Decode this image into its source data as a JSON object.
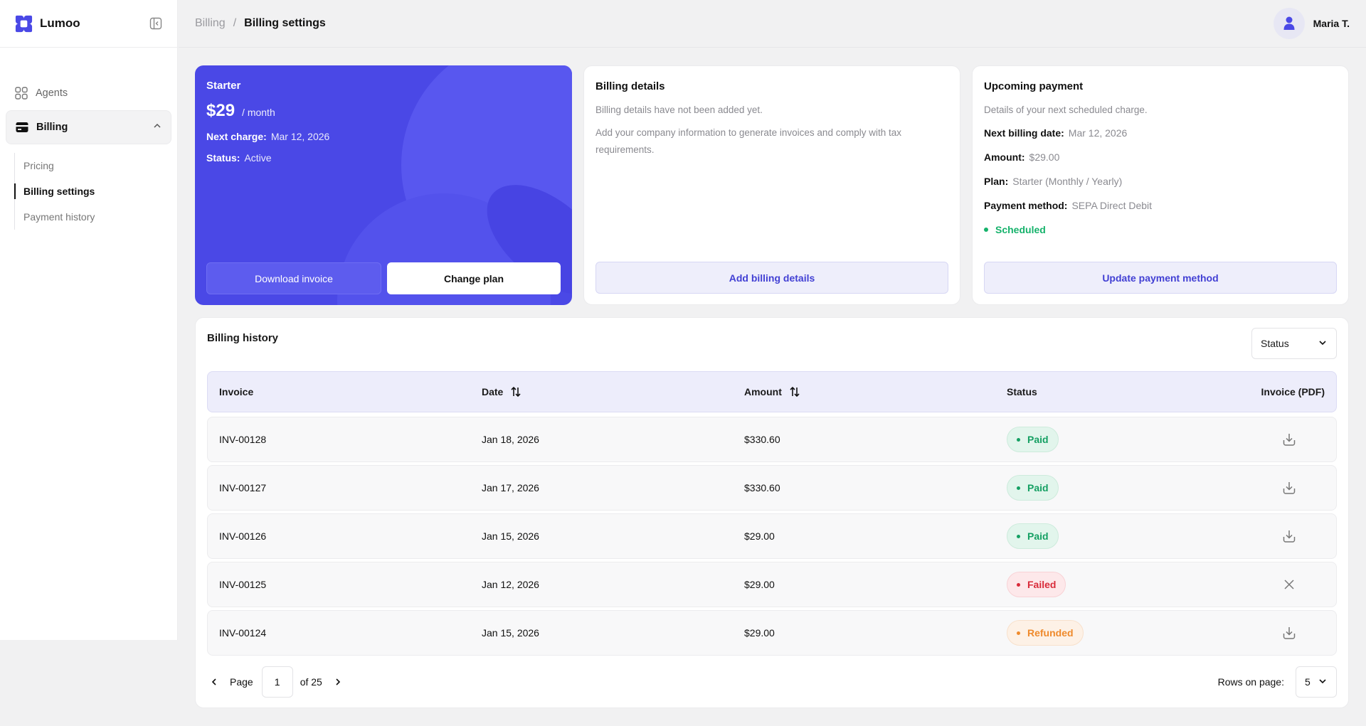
{
  "app": {
    "name": "Lumoo"
  },
  "sidebar": {
    "items": [
      {
        "label": "Agents",
        "icon": "grid-icon"
      },
      {
        "label": "Billing",
        "icon": "credit-card-icon"
      }
    ],
    "sub_items": [
      {
        "label": "Pricing"
      },
      {
        "label": "Billing settings"
      },
      {
        "label": "Payment history"
      }
    ]
  },
  "header": {
    "breadcrumb_parent": "Billing",
    "breadcrumb_sep": "/",
    "breadcrumb_current": "Billing settings",
    "user_name": "Maria T."
  },
  "plan": {
    "name": "Starter",
    "price": "$29",
    "period": "/ month",
    "next_charge_label": "Next charge:",
    "next_charge_value": "Mar 12, 2026",
    "status_label": "Status:",
    "status_value": "Active",
    "download_label": "Download invoice",
    "change_label": "Change plan",
    "accent": "#4a48e6"
  },
  "billing_details": {
    "title": "Billing details",
    "desc1": "Billing details have not been added yet.",
    "desc2": "Add your company information to generate invoices and comply with tax requirements.",
    "button": "Add billing details"
  },
  "upcoming": {
    "title": "Upcoming payment",
    "desc": "Details of your next scheduled charge.",
    "next_date_label": "Next billing date:",
    "next_date_value": "Mar 12, 2026",
    "amount_label": "Amount:",
    "amount_value": "$29.00",
    "plan_label": "Plan:",
    "plan_value": "Starter (Monthly / Yearly)",
    "method_label": "Payment method:",
    "method_value": "SEPA Direct Debit",
    "status": "Scheduled",
    "button": "Update payment method"
  },
  "history": {
    "title": "Billing history",
    "filter_label": "Status",
    "columns": [
      "Invoice",
      "Date",
      "Amount",
      "Status",
      "Invoice (PDF)"
    ],
    "rows": [
      {
        "invoice": "INV-00128",
        "date": "Jan 18, 2026",
        "amount": "$330.60",
        "status": "Paid",
        "action": "download-icon"
      },
      {
        "invoice": "INV-00127",
        "date": "Jan 17, 2026",
        "amount": "$330.60",
        "status": "Paid",
        "action": "download-icon"
      },
      {
        "invoice": "INV-00126",
        "date": "Jan 15, 2026",
        "amount": "$29.00",
        "status": "Paid",
        "action": "download-icon"
      },
      {
        "invoice": "INV-00125",
        "date": "Jan 12, 2026",
        "amount": "$29.00",
        "status": "Failed",
        "action": "close-icon"
      },
      {
        "invoice": "INV-00124",
        "date": "Jan 15, 2026",
        "amount": "$29.00",
        "status": "Refunded",
        "action": "download-icon"
      }
    ],
    "pager": {
      "page_label": "Page",
      "page": "1",
      "of_label": "of 25"
    },
    "rows_on_page_label": "Rows on page:",
    "rows_on_page_value": "5"
  }
}
